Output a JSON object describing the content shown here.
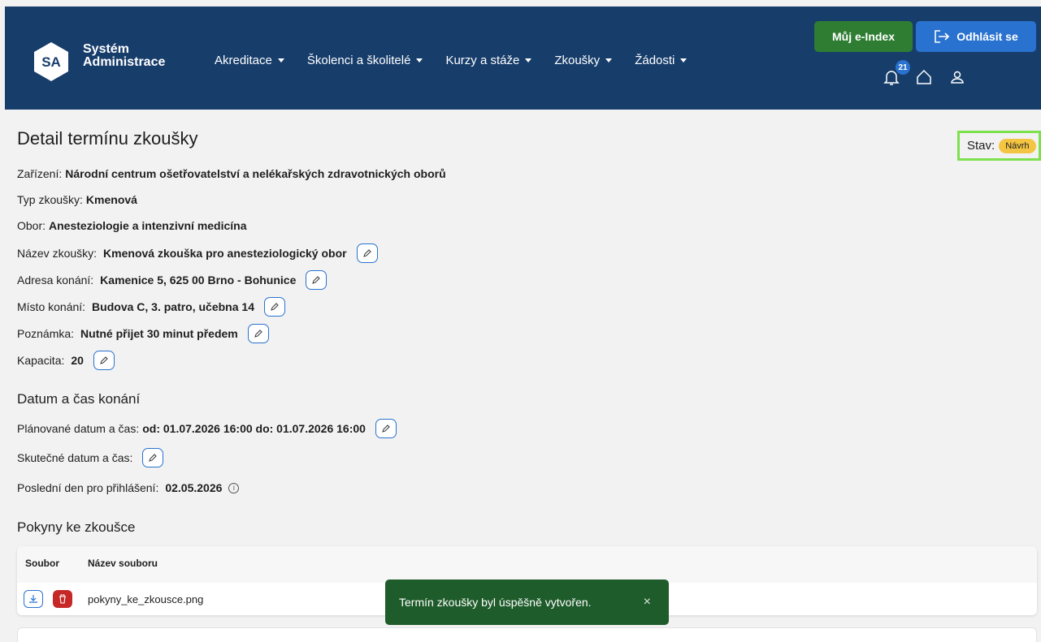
{
  "header": {
    "logo_mark": "SA",
    "app_name_line1": "Systém",
    "app_name_line2": "Administrace",
    "nav": [
      {
        "label": "Akreditace"
      },
      {
        "label": "Školenci a školitelé"
      },
      {
        "label": "Kurzy a stáže"
      },
      {
        "label": "Zkoušky"
      },
      {
        "label": "Žádosti"
      }
    ],
    "eindex_label": "Můj e-Index",
    "logout_label": "Odhlásit se",
    "notification_count": "21",
    "colors": {
      "header_bg": "#173d6b",
      "eindex": "#2e7d32",
      "logout": "#2a72cf"
    }
  },
  "page": {
    "title": "Detail termínu zkoušky",
    "state_label": "Stav:",
    "state_value": "Návrh",
    "fields": {
      "zarizeni_label": "Zařízení:",
      "zarizeni_value": "Národní centrum ošetřovatelství a nelékařských zdravotnických oborů",
      "typ_label": "Typ zkoušky:",
      "typ_value": "Kmenová",
      "obor_label": "Obor:",
      "obor_value": "Anesteziologie a intenzivní medicína",
      "nazev_label": "Název zkoušky:",
      "nazev_value": "Kmenová zkouška pro anesteziologický obor",
      "adresa_label": "Adresa konání:",
      "adresa_value": "Kamenice 5, 625 00 Brno - Bohunice",
      "misto_label": "Místo konání:",
      "misto_value": "Budova C, 3. patro, učebna 14",
      "poznamka_label": "Poznámka:",
      "poznamka_value": "Nutné přijet 30 minut předem",
      "kapacita_label": "Kapacita:",
      "kapacita_value": "20"
    },
    "datetime_heading": "Datum a čas konání",
    "planned_label": "Plánované datum a čas:",
    "planned_value": "od: 01.07.2026 16:00 do: 01.07.2026 16:00",
    "actual_label": "Skutečné datum a čas:",
    "last_day_label": "Poslední den pro přihlášení:",
    "last_day_value": "02.05.2026",
    "instructions_heading": "Pokyny ke zkoušce",
    "table": {
      "col_file": "Soubor",
      "col_filename": "Název souboru",
      "rows": [
        {
          "filename": "pokyny_ke_zkousce.png"
        }
      ]
    }
  },
  "toast": {
    "message": "Termín zkoušky byl úspěšně vytvořen.",
    "close": "×"
  }
}
